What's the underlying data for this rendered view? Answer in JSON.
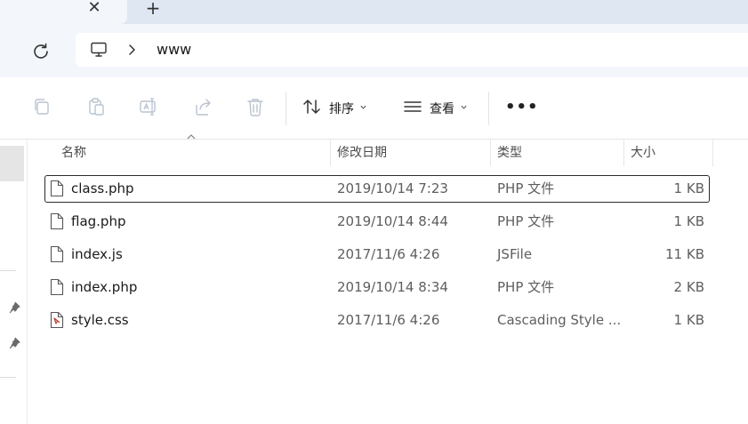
{
  "tabs": {
    "close_glyph": "✕",
    "new_tab_glyph": "+"
  },
  "address": {
    "path": "www"
  },
  "toolbar": {
    "sort_label": "排序",
    "view_label": "查看",
    "more_glyph": "•••"
  },
  "columns": {
    "name": "名称",
    "modified": "修改日期",
    "type": "类型",
    "size": "大小"
  },
  "files": [
    {
      "name": "class.php",
      "modified": "2019/10/14 7:23",
      "type": "PHP 文件",
      "size": "1 KB",
      "icon": "file-icon"
    },
    {
      "name": "flag.php",
      "modified": "2019/10/14 8:44",
      "type": "PHP 文件",
      "size": "1 KB",
      "icon": "file-icon"
    },
    {
      "name": "index.js",
      "modified": "2017/11/6 4:26",
      "type": "JSFile",
      "size": "11 KB",
      "icon": "file-icon"
    },
    {
      "name": "index.php",
      "modified": "2019/10/14 8:34",
      "type": "PHP 文件",
      "size": "2 KB",
      "icon": "file-icon"
    },
    {
      "name": "style.css",
      "modified": "2017/11/6 4:26",
      "type": "Cascading Style ...",
      "size": "1 KB",
      "icon": "css-file-icon"
    }
  ],
  "colors": {
    "tab_strip": "#dfe7f3",
    "address_row": "#f3f6fb",
    "selection_border": "#2b2b2b"
  }
}
